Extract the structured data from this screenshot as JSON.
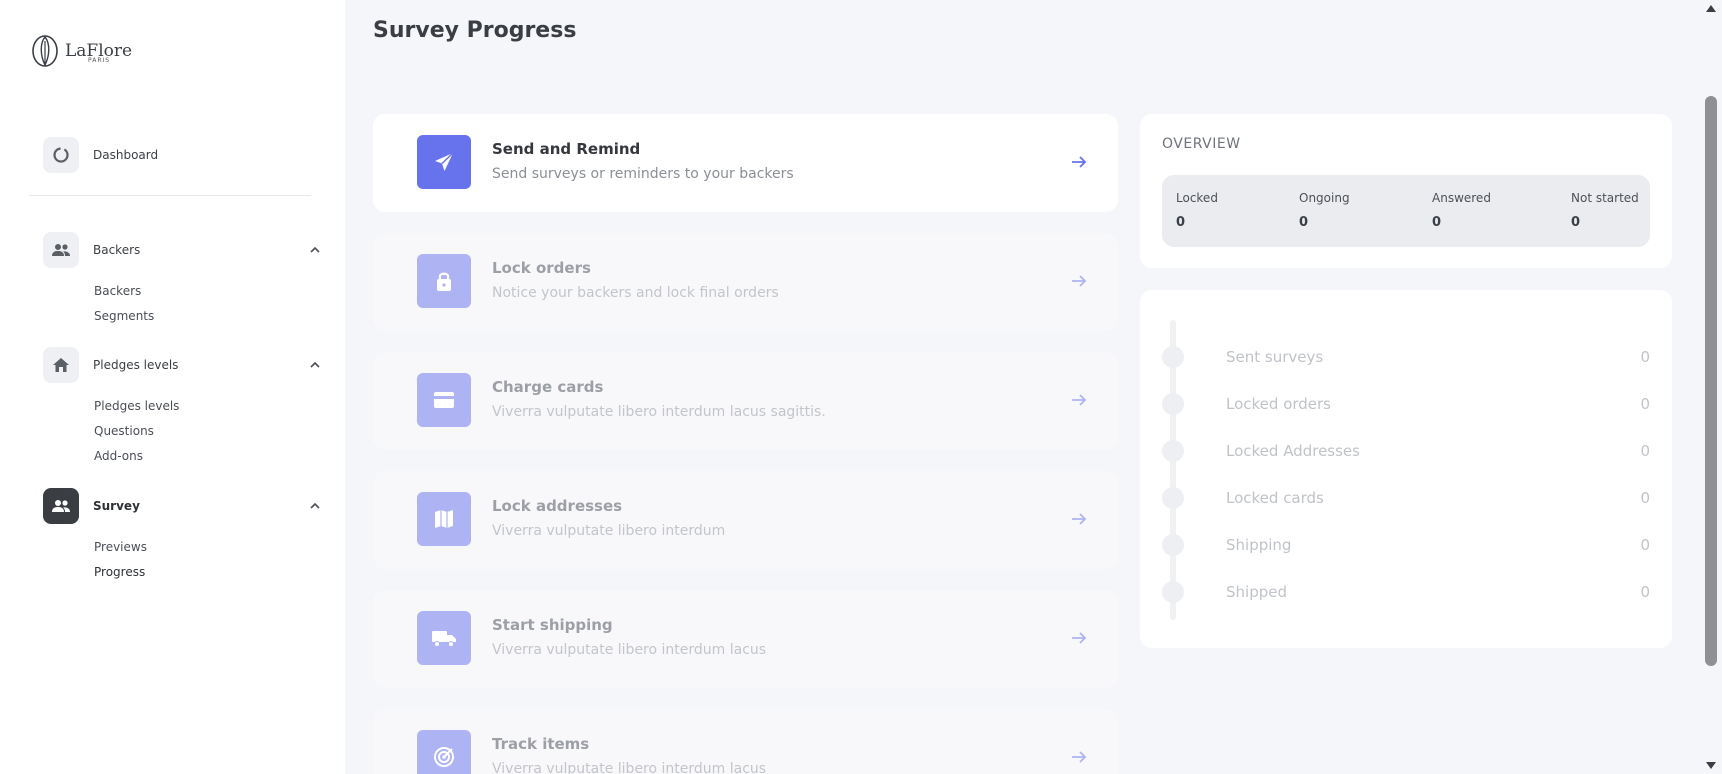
{
  "brand": {
    "name": "LaFlore",
    "sub": "PARIS"
  },
  "sidebar": {
    "dashboard": "Dashboard",
    "groups": [
      {
        "label": "Backers",
        "items": [
          "Backers",
          "Segments"
        ]
      },
      {
        "label": "Pledges levels",
        "items": [
          "Pledges levels",
          "Questions",
          "Add-ons"
        ]
      },
      {
        "label": "Survey",
        "items": [
          "Previews",
          "Progress"
        ]
      }
    ]
  },
  "page": {
    "title": "Survey Progress"
  },
  "cards": [
    {
      "title": "Send and Remind",
      "desc": "Send surveys or reminders to your backers",
      "icon": "send-icon"
    },
    {
      "title": "Lock orders",
      "desc": "Notice your backers and lock final orders",
      "icon": "lock-icon"
    },
    {
      "title": "Charge cards",
      "desc": "Viverra vulputate libero interdum lacus sagittis.",
      "icon": "credit-card-icon"
    },
    {
      "title": "Lock addresses",
      "desc": "Viverra vulputate libero interdum",
      "icon": "map-icon"
    },
    {
      "title": "Start shipping",
      "desc": "Viverra vulputate libero interdum lacus",
      "icon": "truck-icon"
    },
    {
      "title": "Track items",
      "desc": "Viverra vulputate libero interdum lacus",
      "icon": "radar-icon"
    }
  ],
  "overview": {
    "title": "OVERVIEW",
    "stats": [
      {
        "label": "Locked",
        "value": "0"
      },
      {
        "label": "Ongoing",
        "value": "0"
      },
      {
        "label": "Answered",
        "value": "0"
      },
      {
        "label": "Not started",
        "value": "0"
      }
    ]
  },
  "timeline": [
    {
      "label": "Sent surveys",
      "value": "0"
    },
    {
      "label": "Locked orders",
      "value": "0"
    },
    {
      "label": "Locked Addresses",
      "value": "0"
    },
    {
      "label": "Locked cards",
      "value": "0"
    },
    {
      "label": "Shipping",
      "value": "0"
    },
    {
      "label": "Shipped",
      "value": "0"
    }
  ],
  "colors": {
    "accent": "#6773ec",
    "accent_faded": "#aeb3f3"
  }
}
